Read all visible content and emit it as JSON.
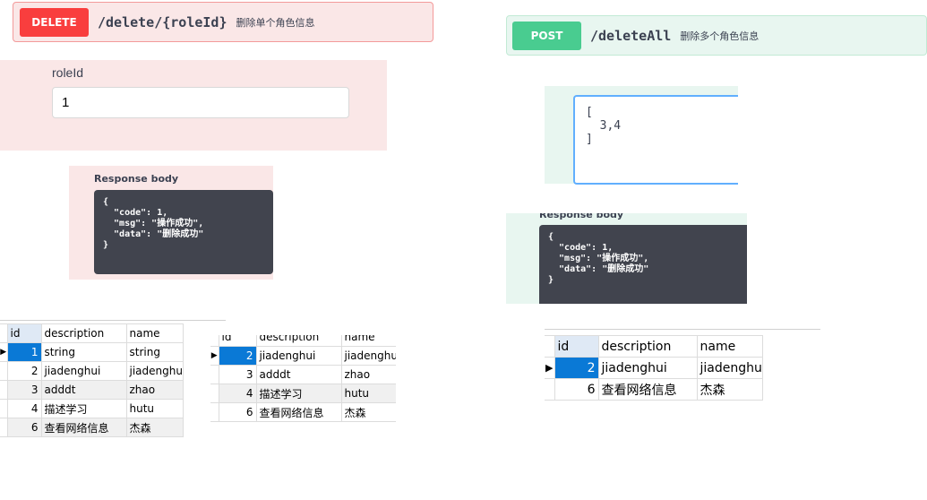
{
  "left": {
    "op": {
      "method": "DELETE",
      "path": "/delete/{roleId}",
      "summary": "删除单个角色信息"
    },
    "param": {
      "label": "roleId",
      "value": "1"
    },
    "response": {
      "title": "Response body",
      "body": "{\n  \"code\": 1,\n  \"msg\": \"操作成功\",\n  \"data\": \"删除成功\"\n}"
    }
  },
  "right": {
    "op": {
      "method": "POST",
      "path": "/deleteAll",
      "summary": "删除多个角色信息"
    },
    "request_body": "[\n  3,4\n]",
    "response": {
      "title": "Response body",
      "body": "{\n  \"code\": 1,\n  \"msg\": \"操作成功\",\n  \"data\": \"删除成功\"\n}"
    }
  },
  "grids": {
    "headers": {
      "id": "id",
      "description": "description",
      "name": "name"
    },
    "before": [
      {
        "id": "1",
        "description": "string",
        "name": "string"
      },
      {
        "id": "2",
        "description": "jiadenghui",
        "name": "jiadenghu"
      },
      {
        "id": "3",
        "description": "adddt",
        "name": "zhao"
      },
      {
        "id": "4",
        "description": "描述学习",
        "name": "hutu"
      },
      {
        "id": "6",
        "description": "查看网络信息",
        "name": "杰森"
      }
    ],
    "after_single": [
      {
        "id": "2",
        "description": "jiadenghui",
        "name": "jiadenghu"
      },
      {
        "id": "3",
        "description": "adddt",
        "name": "zhao"
      },
      {
        "id": "4",
        "description": "描述学习",
        "name": "hutu"
      },
      {
        "id": "6",
        "description": "查看网络信息",
        "name": "杰森"
      }
    ],
    "after_multi": [
      {
        "id": "2",
        "description": "jiadenghui",
        "name": "jiadenghu"
      },
      {
        "id": "6",
        "description": "查看网络信息",
        "name": "杰森"
      }
    ],
    "row_pointer": "▶"
  }
}
